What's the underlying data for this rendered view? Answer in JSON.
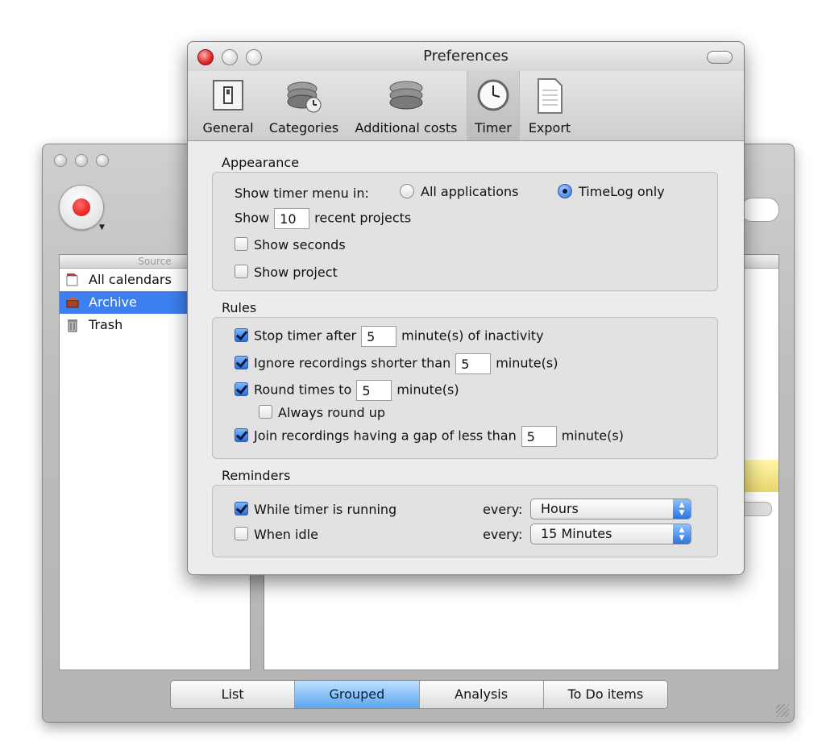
{
  "main_window": {
    "source_header": "Source",
    "sources": [
      {
        "label": "All calendars",
        "icon": "calendar-icon",
        "selected": false
      },
      {
        "label": "Archive",
        "icon": "archive-box-icon",
        "selected": true
      },
      {
        "label": "Trash",
        "icon": "trash-icon",
        "selected": false
      }
    ],
    "view_tabs": [
      {
        "label": "List",
        "active": false
      },
      {
        "label": "Grouped",
        "active": true
      },
      {
        "label": "Analysis",
        "active": false
      },
      {
        "label": "To Do items",
        "active": false
      }
    ]
  },
  "prefs": {
    "title": "Preferences",
    "toolbar": [
      {
        "label": "General",
        "icon": "switch-icon",
        "selected": false
      },
      {
        "label": "Categories",
        "icon": "categories-discs-icon",
        "selected": false
      },
      {
        "label": "Additional costs",
        "icon": "coins-icon",
        "selected": false
      },
      {
        "label": "Timer",
        "icon": "clock-icon",
        "selected": true
      },
      {
        "label": "Export",
        "icon": "document-icon",
        "selected": false
      }
    ],
    "appearance": {
      "section_label": "Appearance",
      "show_timer_menu_label": "Show timer menu in:",
      "radio_all": "All applications",
      "radio_timelog": "TimeLog only",
      "selected_radio": "TimeLog only",
      "show_label": "Show",
      "recent_count": "10",
      "recent_projects_label": "recent projects",
      "show_seconds_label": "Show seconds",
      "show_seconds_checked": false,
      "show_project_label": "Show project",
      "show_project_checked": false
    },
    "rules": {
      "section_label": "Rules",
      "stop_timer_label": "Stop timer after",
      "stop_timer_value": "5",
      "stop_timer_suffix": "minute(s) of inactivity",
      "stop_timer_checked": true,
      "ignore_label": "Ignore recordings shorter than",
      "ignore_value": "5",
      "ignore_suffix": "minute(s)",
      "ignore_checked": true,
      "round_label": "Round times to",
      "round_value": "5",
      "round_suffix": "minute(s)",
      "round_checked": true,
      "always_round_label": "Always round up",
      "always_round_checked": false,
      "join_label": "Join recordings having a gap of less than",
      "join_value": "5",
      "join_suffix": "minute(s)",
      "join_checked": true
    },
    "reminders": {
      "section_label": "Reminders",
      "while_running_label": "While timer is running",
      "while_running_checked": true,
      "while_running_every_label": "every:",
      "while_running_value": "Hours",
      "when_idle_label": "When idle",
      "when_idle_checked": false,
      "when_idle_every_label": "every:",
      "when_idle_value": "15 Minutes"
    }
  },
  "colors": {
    "selection_blue": "#3d7ff0",
    "record_red": "#e00000",
    "close_red": "#e02424"
  }
}
